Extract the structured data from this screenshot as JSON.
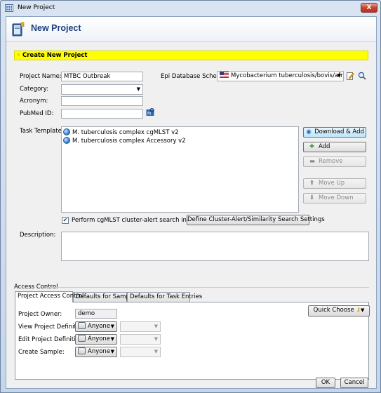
{
  "window": {
    "title": "New Project",
    "close_glyph": "X"
  },
  "header": {
    "title": "New Project",
    "icon": "project-book-icon"
  },
  "section": {
    "title": "Create New Project"
  },
  "form": {
    "project_name_label": "Project Name:",
    "project_name_value": "MTBC Outbreak",
    "category_label": "Category:",
    "category_value": "",
    "acronym_label": "Acronym:",
    "acronym_value": "",
    "pubmed_label": "PubMed ID:",
    "pubmed_value": "",
    "scheme_label": "Epi Database Scheme:",
    "scheme_value": "Mycobacterium tuberculosis/bovis/africanum",
    "task_templates_label": "Task Templates:",
    "task_templates": [
      "M. tuberculosis complex cgMLST v2",
      "M. tuberculosis complex Accessory v2"
    ],
    "buttons": {
      "download_add": "Download & Add",
      "add": "Add",
      "remove": "Remove",
      "move_up": "Move Up",
      "move_down": "Move Down"
    },
    "cluster_alert_checkbox_label": "Perform cgMLST cluster-alert search in pipelines",
    "cluster_alert_checked": true,
    "define_settings_button": "Define Cluster-Alert/Similarity Search Settings",
    "description_label": "Description:",
    "description_value": ""
  },
  "access": {
    "group_title": "Access Control",
    "tabs": [
      "Project Access Control",
      "Defaults for Samples",
      "Defaults for Task Entries"
    ],
    "active_tab": 0,
    "owner_label": "Project Owner:",
    "owner_value": "demo",
    "quick_choose": "Quick Choose",
    "rows": [
      {
        "label": "View Project Definition:",
        "value": "Anyone"
      },
      {
        "label": "Edit Project Definition:",
        "value": "Anyone"
      },
      {
        "label": "Create Sample:",
        "value": "Anyone"
      }
    ]
  },
  "footer": {
    "ok": "OK",
    "cancel": "Cancel"
  },
  "colors": {
    "highlight_band": "#ffff00",
    "title_blue": "#1f3f7a",
    "accent": "#3c7fb1"
  }
}
